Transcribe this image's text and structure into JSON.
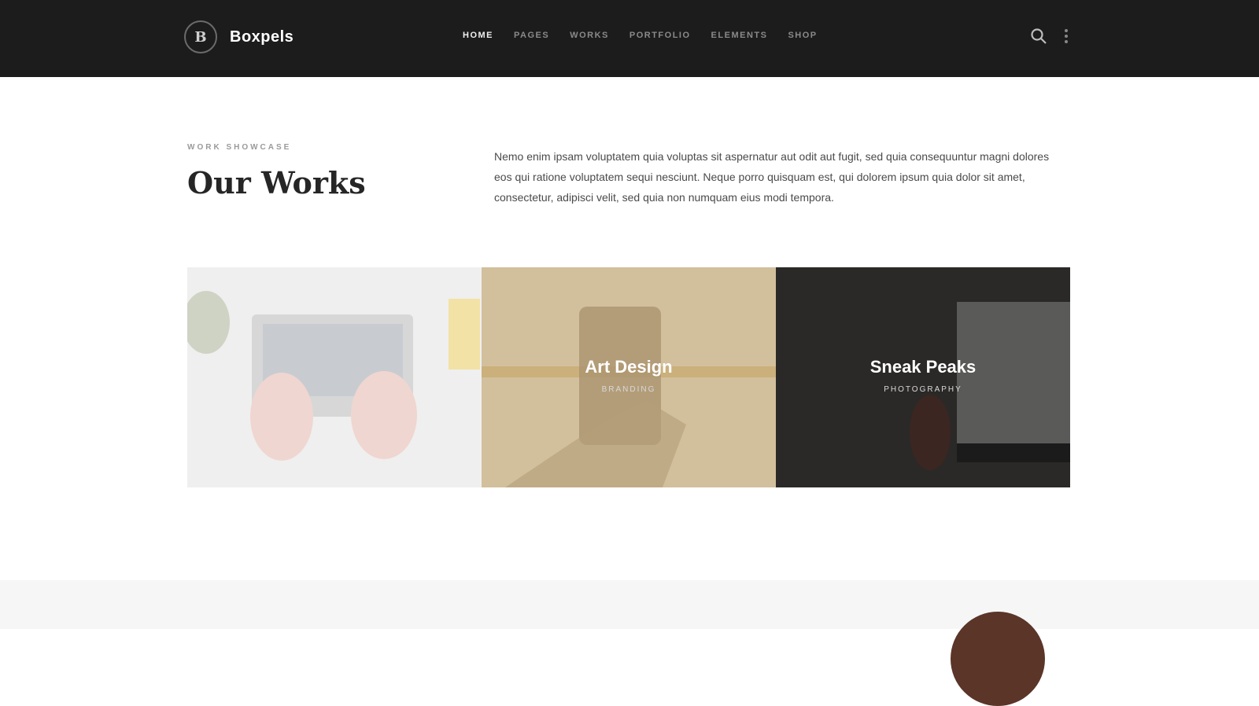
{
  "header": {
    "logo_letter": "B",
    "brand": "Boxpels",
    "nav": [
      {
        "label": "Home",
        "active": true
      },
      {
        "label": "Pages",
        "active": false
      },
      {
        "label": "Works",
        "active": false
      },
      {
        "label": "Portfolio",
        "active": false
      },
      {
        "label": "Elements",
        "active": false
      },
      {
        "label": "Shop",
        "active": false
      }
    ],
    "icons": [
      "search-icon",
      "more-icon"
    ]
  },
  "section": {
    "eyebrow": "WORK SHOWCASE",
    "title": "Our Works",
    "intro": "Nemo enim ipsam voluptatem quia voluptas sit aspernatur aut odit aut fugit, sed quia consequuntur magni dolores eos qui ratione voluptatem sequi nesciunt. Neque porro quisquam est, qui dolorem ipsum quia dolor sit amet, consectetur, adipisci velit, sed quia non numquam eius modi tempora."
  },
  "gallery": [
    {
      "title": "",
      "subtitle": "",
      "theme": "#ececec"
    },
    {
      "title": "Art Design",
      "subtitle": "Branding",
      "theme": "#d3c09f"
    },
    {
      "title": "Sneak Peaks",
      "subtitle": "Photography",
      "theme": "#2d2a27"
    }
  ]
}
